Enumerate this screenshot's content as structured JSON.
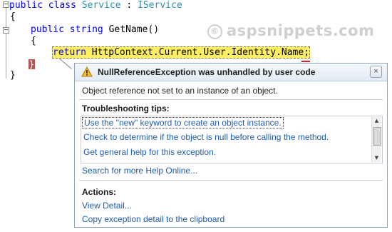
{
  "code": {
    "line1": {
      "kw": "public class ",
      "type1": "Service",
      "sep": " : ",
      "type2": "IService"
    },
    "line2": "{",
    "line3": {
      "kw1": "public",
      "sp": " ",
      "kw2": "string",
      "rest": " GetName()"
    },
    "line4": "{",
    "line5": {
      "kw": "return",
      "rest": " HttpContext.Current.User.Identity.Name;"
    },
    "line6": "}",
    "line7": "}"
  },
  "watermark": {
    "symbol": "©",
    "text": "aspsnippets.com"
  },
  "exception": {
    "title": "NullReferenceException was unhandled by user code",
    "close": "×",
    "message": "Object reference not set to an instance of an object.",
    "tips_heading": "Troubleshooting tips:",
    "tips": [
      "Use the \"new\" keyword to create an object instance.",
      "Check to determine if the object is null before calling the method.",
      "Get general help for this exception."
    ],
    "search_help": "Search for more Help Online...",
    "actions_heading": "Actions:",
    "actions": [
      "View Detail...",
      "Copy exception detail to the clipboard"
    ]
  },
  "icons": {
    "warning": "warning-icon",
    "collapse": "collapse-icon"
  },
  "colors": {
    "keyword": "#0000ff",
    "type": "#2b91af",
    "highlight": "#ffee62",
    "link": "#1f5cb3"
  }
}
